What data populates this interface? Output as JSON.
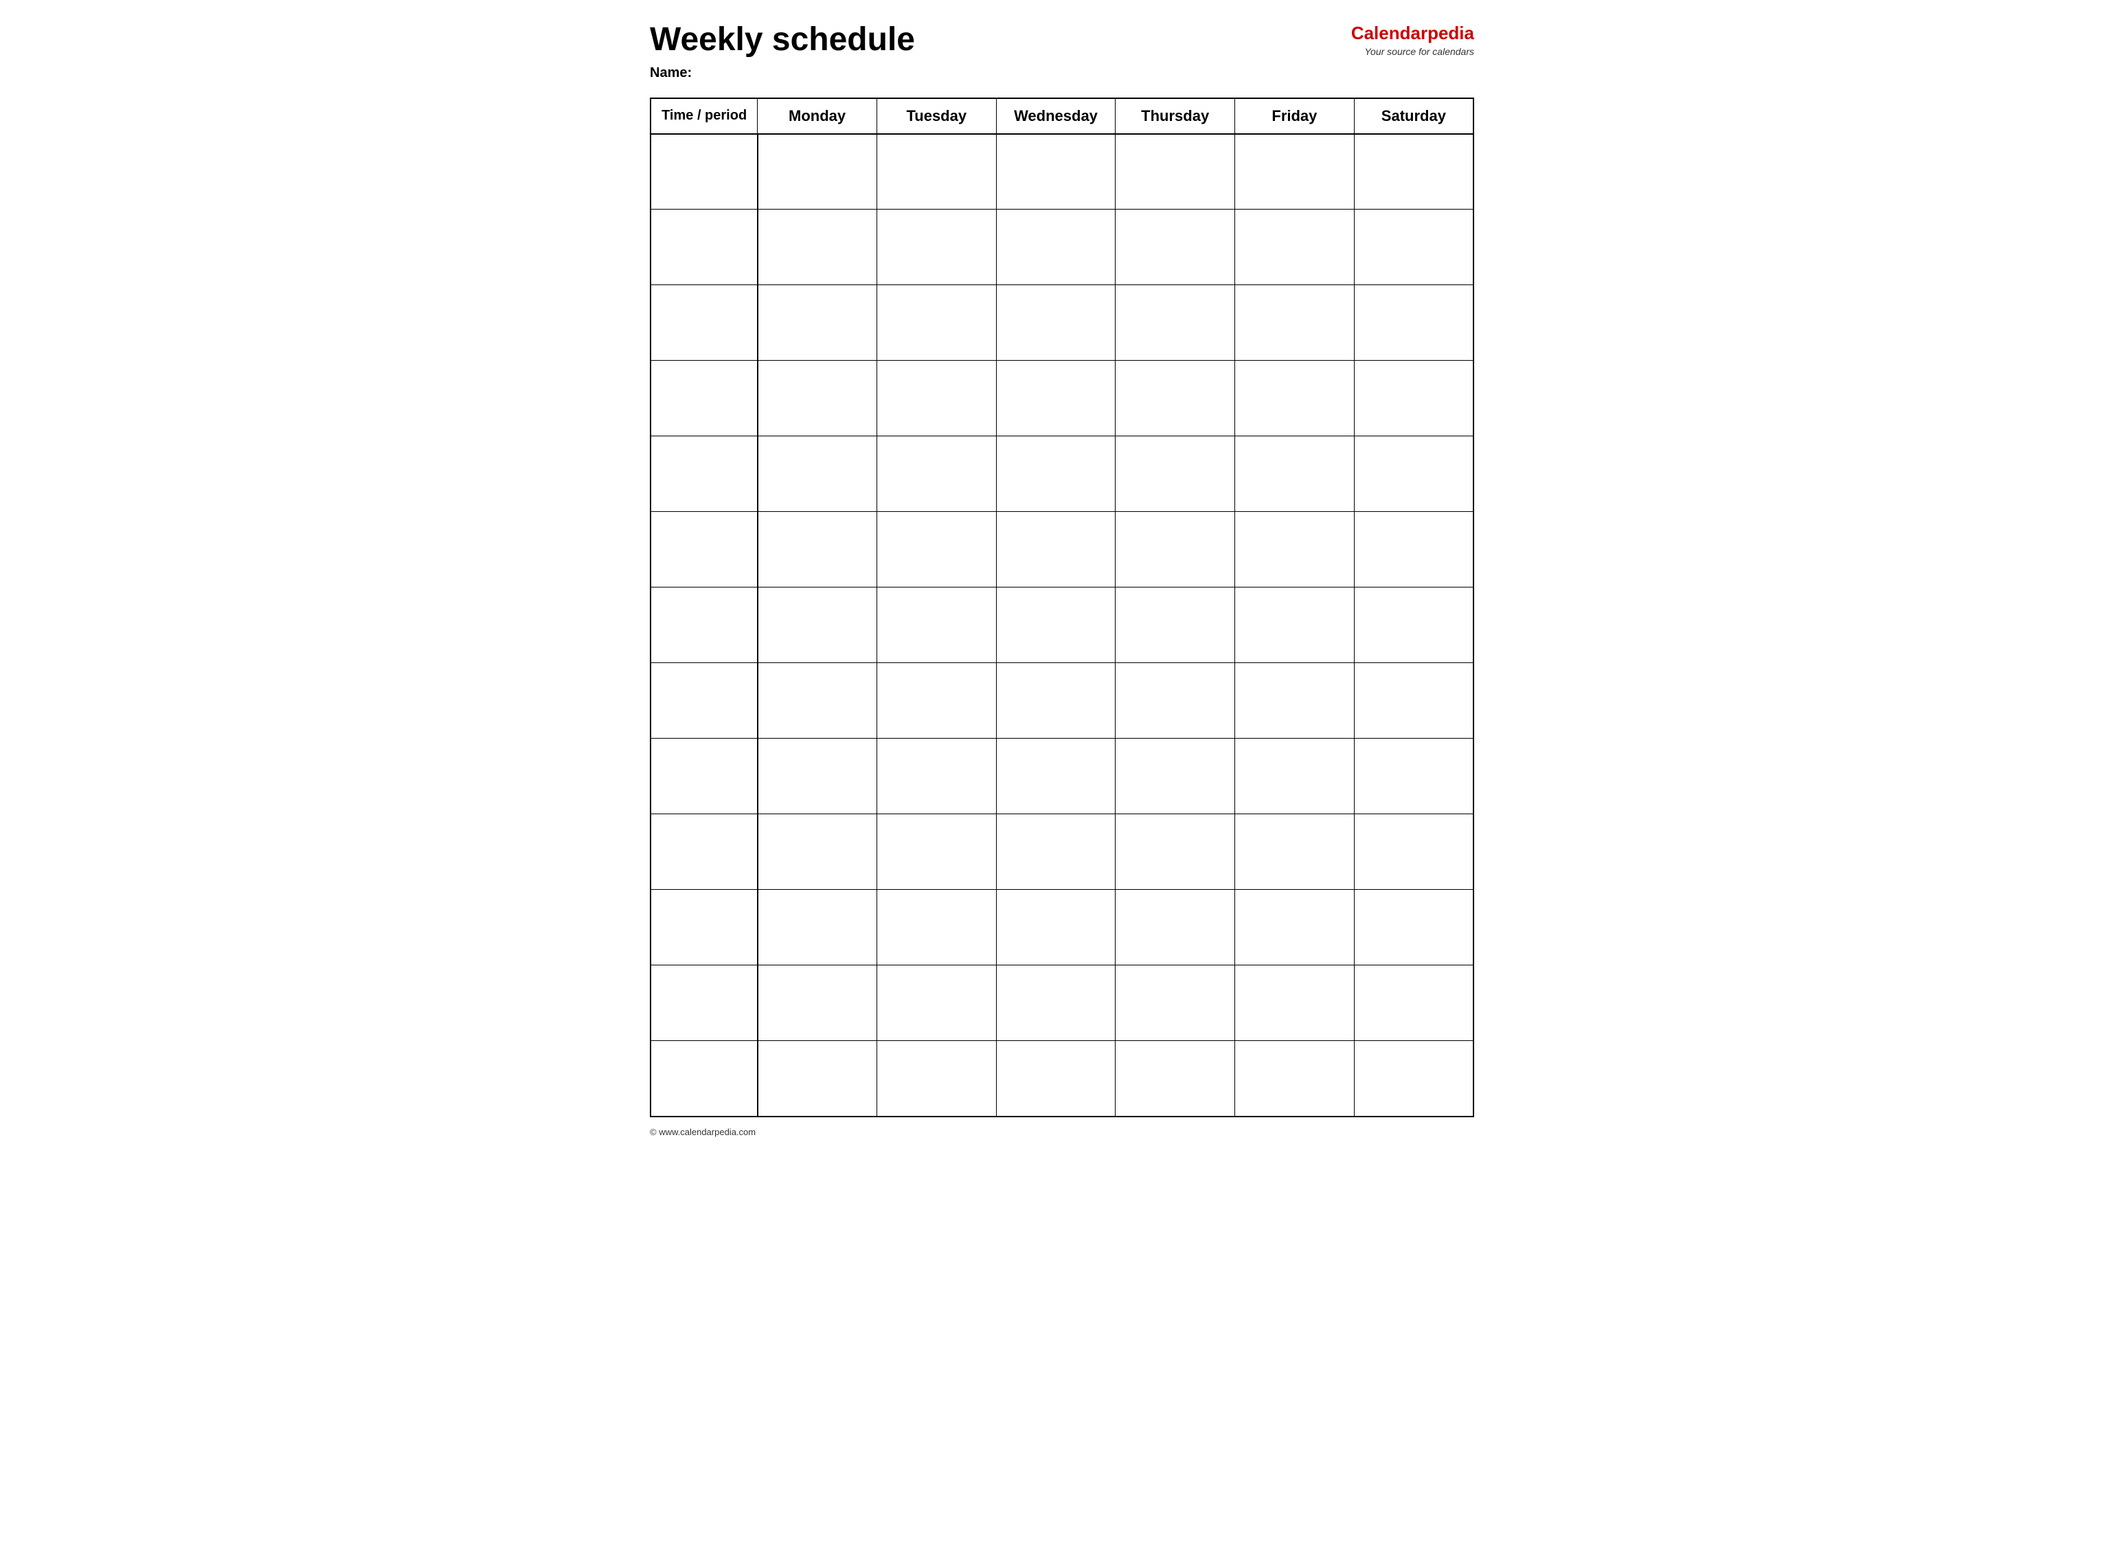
{
  "header": {
    "title": "Weekly schedule",
    "name_label": "Name:",
    "logo_brand_part1": "Calendar",
    "logo_brand_part2": "pedia",
    "logo_tagline": "Your source for calendars"
  },
  "table": {
    "columns": [
      "Time / period",
      "Monday",
      "Tuesday",
      "Wednesday",
      "Thursday",
      "Friday",
      "Saturday"
    ],
    "row_count": 13
  },
  "footer": {
    "copyright": "© www.calendarpedia.com"
  }
}
